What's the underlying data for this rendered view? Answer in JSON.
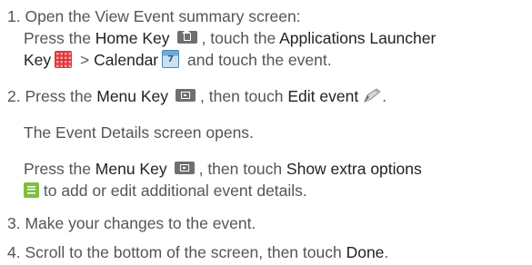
{
  "step1": {
    "line1": "1. Open the View Event summary screen:",
    "line2_pre": "Press the ",
    "home_key": "Home Key",
    "line2_mid": ", touch the ",
    "apps_launcher": "Applications Launcher",
    "key_label": "Key",
    "sep": " > ",
    "calendar": "Calendar",
    "line3_post": " and touch the event.",
    "icons": {
      "home": "home-icon",
      "apps": "applications-launcher-icon",
      "calendar": "calendar-icon"
    }
  },
  "step2": {
    "pre": "2. Press the ",
    "menu_key": "Menu Key",
    "mid": ", then touch ",
    "edit_event": "Edit event",
    "post": ".",
    "icons": {
      "menu": "menu-icon",
      "edit": "pencil-icon"
    }
  },
  "event_details_opens": "The Event Details screen opens.",
  "extra": {
    "pre": "Press the ",
    "menu_key": "Menu Key",
    "mid": ", then touch ",
    "show_extra": "Show extra options",
    "line2_post": " to add or edit additional event details.",
    "icons": {
      "menu": "menu-icon",
      "extra": "extra-options-icon"
    }
  },
  "step3": "3. Make your changes to the event.",
  "step4": {
    "pre": "4. Scroll to the bottom of the screen, then touch ",
    "done": "Done",
    "post": "."
  },
  "colors": {
    "body_text": "#555555",
    "bold_text": "#222222",
    "apps_icon": "#e3343a",
    "calendar_icon": "#6ea9d8",
    "extra_icon": "#7fbf3f"
  }
}
